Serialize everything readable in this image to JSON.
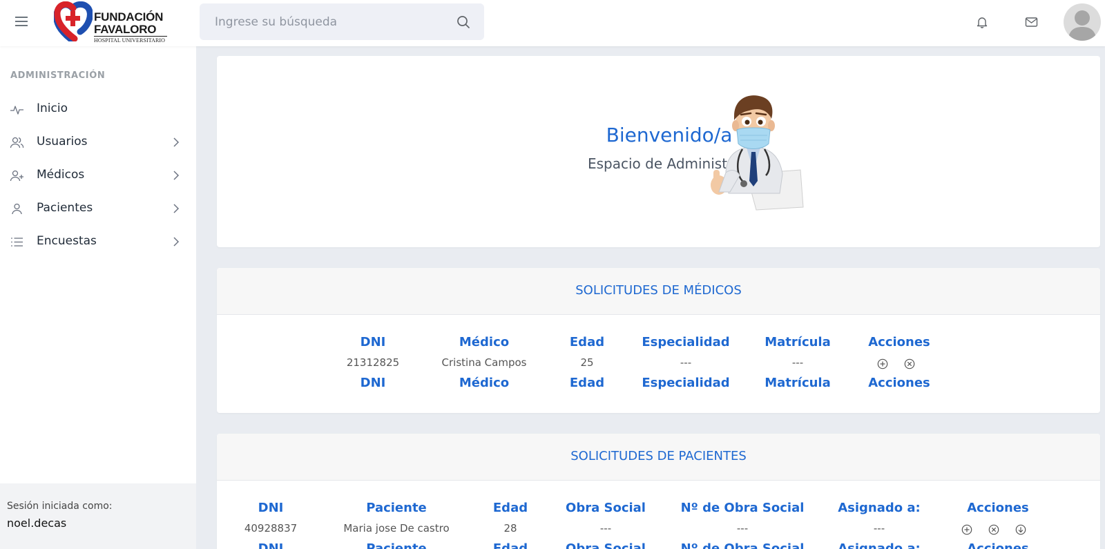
{
  "header": {
    "search_placeholder": "Ingrese su búsqueda",
    "logo": {
      "line1": "FUNDACIÓN",
      "line2": "FAVALORO",
      "line3": "HOSPITAL UNIVERSITARIO"
    },
    "icons": [
      "menu-icon",
      "search-icon",
      "bell-icon",
      "mail-icon",
      "user-avatar-icon"
    ]
  },
  "sidebar": {
    "heading": "ADMINISTRACIÓN",
    "items": [
      {
        "label": "Inicio",
        "icon": "activity-icon",
        "has_submenu": false
      },
      {
        "label": "Usuarios",
        "icon": "users-icon",
        "has_submenu": true
      },
      {
        "label": "Médicos",
        "icon": "user-plus-icon",
        "has_submenu": true
      },
      {
        "label": "Pacientes",
        "icon": "user-icon",
        "has_submenu": true
      },
      {
        "label": "Encuestas",
        "icon": "list-icon",
        "has_submenu": true
      }
    ],
    "session_label": "Sesión iniciada como:",
    "session_user": "noel.decas"
  },
  "welcome": {
    "title": "Bienvenido/a",
    "subtitle": "Espacio de Administración"
  },
  "medicos": {
    "title": "SOLICITUDES DE MÉDICOS",
    "columns": [
      "DNI",
      "Médico",
      "Edad",
      "Especialidad",
      "Matrícula",
      "Acciones"
    ],
    "rows": [
      [
        "21312825",
        "Cristina Campos",
        "25",
        "---",
        "---"
      ]
    ],
    "actions": [
      "add-circle-icon",
      "cancel-circle-icon"
    ]
  },
  "pacientes": {
    "title": "SOLICITUDES DE PACIENTES",
    "columns": [
      "DNI",
      "Paciente",
      "Edad",
      "Obra Social",
      "Nº de Obra Social",
      "Asignado a:",
      "Acciones"
    ],
    "rows": [
      [
        "40928837",
        "Maria jose De castro",
        "28",
        "---",
        "---",
        "---"
      ]
    ],
    "actions": [
      "add-circle-icon",
      "cancel-circle-icon",
      "download-circle-icon"
    ]
  },
  "colors": {
    "accent": "#1e68d1",
    "background": "#e9ecf1",
    "search_bg": "#eef0f6",
    "session_bg": "#f2f3f5"
  }
}
